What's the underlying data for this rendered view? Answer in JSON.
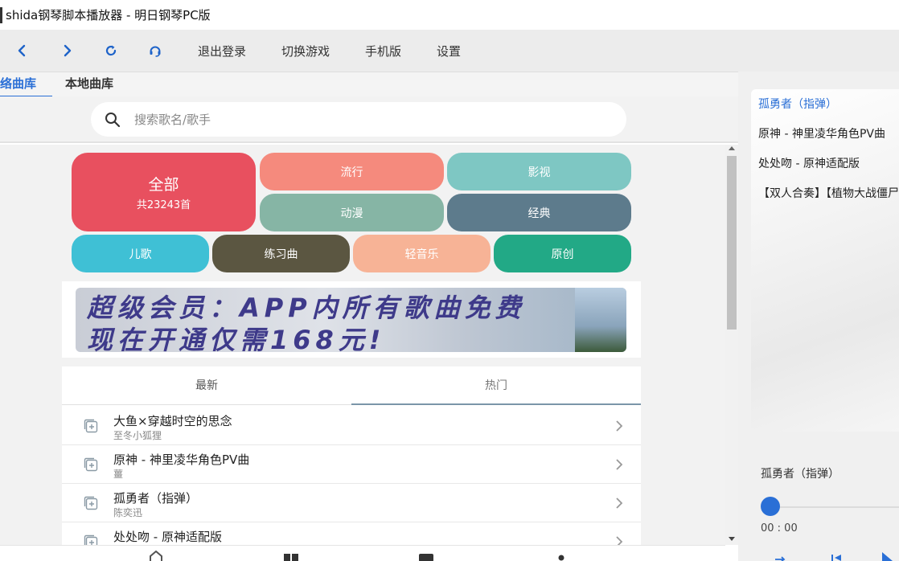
{
  "window": {
    "title": "shida钢琴脚本播放器 - 明日钢琴PC版"
  },
  "toolbar": {
    "icons": [
      "back-icon",
      "forward-icon",
      "refresh-icon",
      "headset-icon"
    ],
    "links": [
      "退出登录",
      "切换游戏",
      "手机版",
      "设置"
    ]
  },
  "tabs": [
    {
      "label": "络曲库",
      "active": true
    },
    {
      "label": "本地曲库",
      "active": false
    }
  ],
  "search": {
    "placeholder": "搜索歌名/歌手",
    "value": ""
  },
  "categories": {
    "all": {
      "label": "全部",
      "count": "共23243首",
      "color": "#e8505f"
    },
    "items": [
      {
        "label": "流行",
        "color": "#f58a7d"
      },
      {
        "label": "影视",
        "color": "#7ec7c3"
      },
      {
        "label": "动漫",
        "color": "#86b5a5"
      },
      {
        "label": "经典",
        "color": "#5d7b8c"
      },
      {
        "label": "儿歌",
        "color": "#3fc0d5"
      },
      {
        "label": "练习曲",
        "color": "#5b5641"
      },
      {
        "label": "轻音乐",
        "color": "#f7b396"
      },
      {
        "label": "原创",
        "color": "#22a986"
      }
    ]
  },
  "banner": {
    "line1": "超级会员：APP内所有歌曲免费",
    "line2": "现在开通仅需168元!"
  },
  "list_tabs": [
    {
      "label": "最新",
      "active": false
    },
    {
      "label": "热门",
      "active": true
    }
  ],
  "songs": [
    {
      "title": "大鱼×穿越时空的思念",
      "artist": "至冬小狐狸"
    },
    {
      "title": "原神 - 神里凌华角色PV曲",
      "artist": "薑"
    },
    {
      "title": "孤勇者（指弹）",
      "artist": "陈奕迅"
    },
    {
      "title": "处处吻 - 原神适配版",
      "artist": ""
    }
  ],
  "bottom_nav": [
    "home-icon",
    "grid-icon",
    "square-icon",
    "user-icon"
  ],
  "playlist": [
    {
      "title": "孤勇者（指弹）",
      "active": true
    },
    {
      "title": "原神 - 神里凌华角色PV曲",
      "active": false
    },
    {
      "title": "处处吻 - 原神适配版",
      "active": false
    },
    {
      "title": "【双人合奏】【植物大战僵尸",
      "active": false
    }
  ],
  "player": {
    "now_playing": "孤勇者（指弹）",
    "time": "00 : 00",
    "progress": 0,
    "accent": "#2a6fd6"
  }
}
